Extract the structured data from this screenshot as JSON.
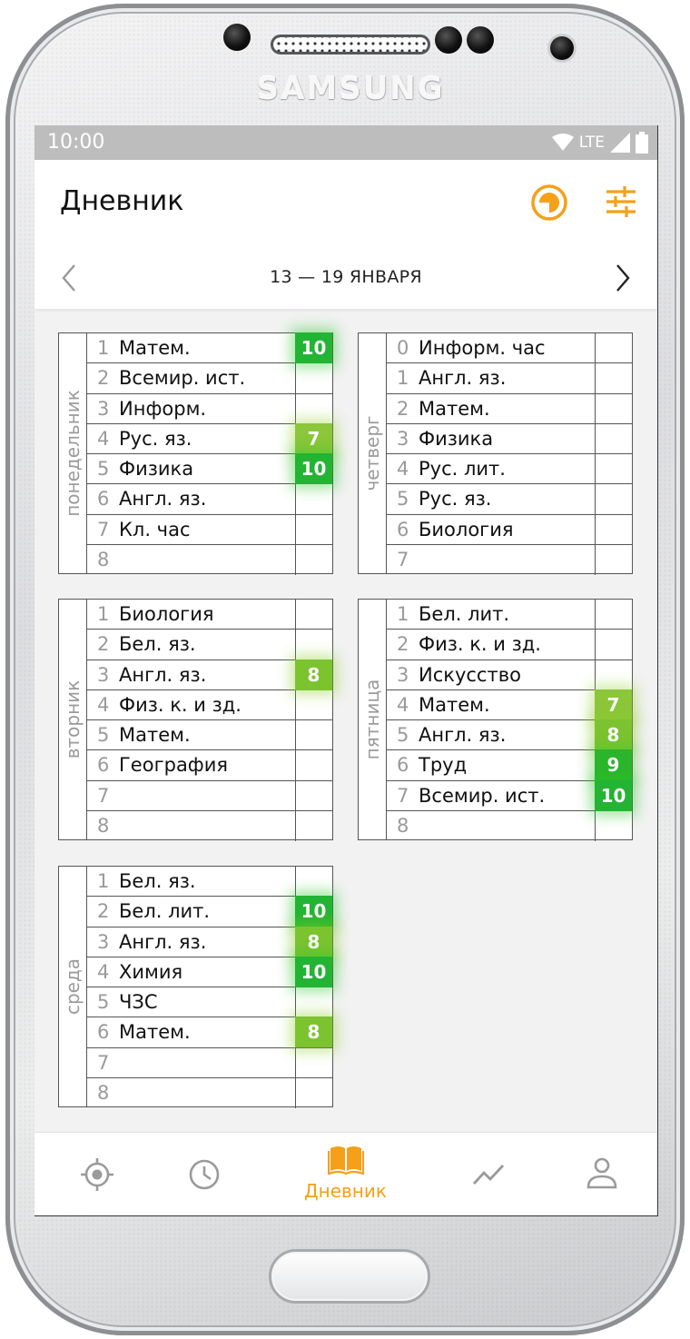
{
  "device": {
    "brand": "SAMSUNG"
  },
  "status_bar": {
    "time": "10:00",
    "network": "LTE"
  },
  "header": {
    "title": "Дневник"
  },
  "week": {
    "range": "13 — 19 ЯНВАРЯ"
  },
  "colors": {
    "accent": "#f5a01a",
    "grade_high": "#22b432",
    "grade_mid": "#7cc330"
  },
  "days": [
    {
      "name": "понедельник",
      "lessons": [
        {
          "num": "1",
          "subject": "Матем.",
          "grade": "10"
        },
        {
          "num": "2",
          "subject": "Всемир. ист.",
          "grade": ""
        },
        {
          "num": "3",
          "subject": "Информ.",
          "grade": ""
        },
        {
          "num": "4",
          "subject": "Рус. яз.",
          "grade": "7"
        },
        {
          "num": "5",
          "subject": "Физика",
          "grade": "10"
        },
        {
          "num": "6",
          "subject": "Англ. яз.",
          "grade": ""
        },
        {
          "num": "7",
          "subject": "Кл. час",
          "grade": ""
        },
        {
          "num": "8",
          "subject": "",
          "grade": ""
        }
      ]
    },
    {
      "name": "четверг",
      "lessons": [
        {
          "num": "0",
          "subject": "Информ. час",
          "grade": ""
        },
        {
          "num": "1",
          "subject": "Англ. яз.",
          "grade": ""
        },
        {
          "num": "2",
          "subject": "Матем.",
          "grade": ""
        },
        {
          "num": "3",
          "subject": "Физика",
          "grade": ""
        },
        {
          "num": "4",
          "subject": "Рус. лит.",
          "grade": ""
        },
        {
          "num": "5",
          "subject": "Рус. яз.",
          "grade": ""
        },
        {
          "num": "6",
          "subject": "Биология",
          "grade": ""
        },
        {
          "num": "7",
          "subject": "",
          "grade": ""
        }
      ]
    },
    {
      "name": "вторник",
      "lessons": [
        {
          "num": "1",
          "subject": "Биология",
          "grade": ""
        },
        {
          "num": "2",
          "subject": "Бел. яз.",
          "grade": ""
        },
        {
          "num": "3",
          "subject": "Англ. яз.",
          "grade": "8"
        },
        {
          "num": "4",
          "subject": "Физ. к. и зд.",
          "grade": ""
        },
        {
          "num": "5",
          "subject": "Матем.",
          "grade": ""
        },
        {
          "num": "6",
          "subject": "География",
          "grade": ""
        },
        {
          "num": "7",
          "subject": "",
          "grade": ""
        },
        {
          "num": "8",
          "subject": "",
          "grade": ""
        }
      ]
    },
    {
      "name": "пятница",
      "lessons": [
        {
          "num": "1",
          "subject": "Бел. лит.",
          "grade": ""
        },
        {
          "num": "2",
          "subject": "Физ. к. и зд.",
          "grade": ""
        },
        {
          "num": "3",
          "subject": "Искусство",
          "grade": ""
        },
        {
          "num": "4",
          "subject": "Матем.",
          "grade": "7"
        },
        {
          "num": "5",
          "subject": "Англ. яз.",
          "grade": "8"
        },
        {
          "num": "6",
          "subject": "Труд",
          "grade": "9"
        },
        {
          "num": "7",
          "subject": "Всемир. ист.",
          "grade": "10"
        },
        {
          "num": "8",
          "subject": "",
          "grade": ""
        }
      ]
    },
    {
      "name": "среда",
      "lessons": [
        {
          "num": "1",
          "subject": "Бел. яз.",
          "grade": ""
        },
        {
          "num": "2",
          "subject": "Бел. лит.",
          "grade": "10"
        },
        {
          "num": "3",
          "subject": "Англ. яз.",
          "grade": "8"
        },
        {
          "num": "4",
          "subject": "Химия",
          "grade": "10"
        },
        {
          "num": "5",
          "subject": "ЧЗС",
          "grade": ""
        },
        {
          "num": "6",
          "subject": "Матем.",
          "grade": "8"
        },
        {
          "num": "7",
          "subject": "",
          "grade": ""
        },
        {
          "num": "8",
          "subject": "",
          "grade": ""
        }
      ]
    }
  ],
  "bottom_nav": [
    {
      "icon": "target-icon",
      "label": ""
    },
    {
      "icon": "clock-icon",
      "label": ""
    },
    {
      "icon": "book-icon",
      "label": "Дневник",
      "active": true
    },
    {
      "icon": "chart-icon",
      "label": ""
    },
    {
      "icon": "person-icon",
      "label": ""
    }
  ]
}
